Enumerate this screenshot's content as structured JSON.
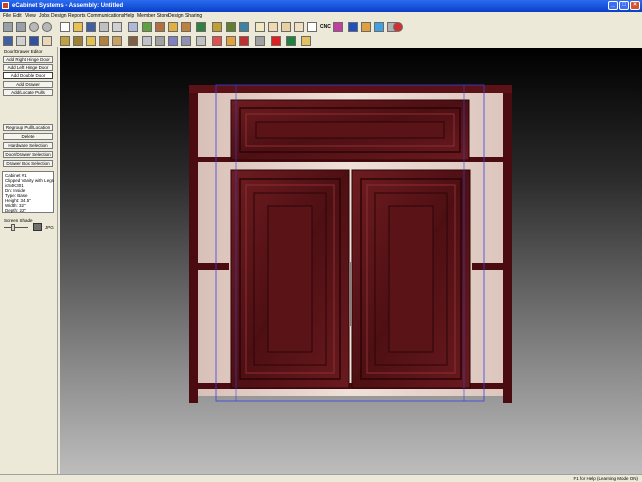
{
  "window": {
    "title": "eCabinet Systems - Assembly: Untitled",
    "minimize": "_",
    "maximize": "□",
    "close": "×"
  },
  "menu": [
    "File",
    "Edit",
    "View",
    "Jobs",
    "Design",
    "Reports",
    "Communications",
    "Help",
    "Member Store",
    "Design Sharing"
  ],
  "toolbar": {
    "cnc_label": "CNC"
  },
  "left_panel": {
    "editor_title": "Door/Drawer Editor",
    "buttons": [
      {
        "label": "Add Right Hinge Door"
      },
      {
        "label": "Add Left Hinge Door"
      },
      {
        "label": "Add Double Door"
      },
      {
        "label": "Add Drawer"
      },
      {
        "label": "Add/Locate Pulls"
      }
    ],
    "buttons2": [
      {
        "label": "Regroup Pull/Location"
      },
      {
        "label": "Delete"
      },
      {
        "label": "Hardware Selection"
      },
      {
        "label": "Door/Drawer Selection"
      },
      {
        "label": "Drawer Box Selection"
      }
    ],
    "info": [
      "Cabinet #1",
      "Clipped Vanity with Legs",
      "ic54K301",
      "Dn: Inside",
      "Type: Base",
      "Height: 34.5\"",
      "Width: 32\"",
      "Depth: 22\""
    ],
    "shade_label": "Screen Shade",
    "jpg_label": "JPG"
  },
  "status": {
    "text": "F1 for Help (Learning Mode ON)"
  },
  "colors": {
    "wood": "#5e1418",
    "wood_dark": "#3a0709",
    "wood_light": "#7a2428",
    "maple": "#e6d4cc",
    "outline": "#3a40e0"
  }
}
